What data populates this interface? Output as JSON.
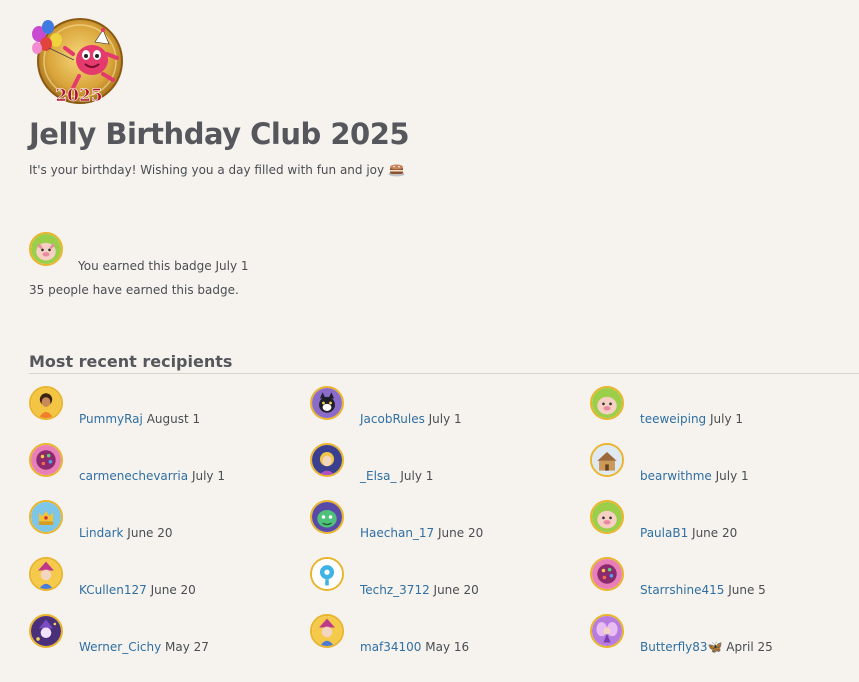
{
  "badge": {
    "year_label": "2025",
    "title": "Jelly Birthday Club 2025",
    "description": "It's your birthday! Wishing you a day filled with fun and joy",
    "description_icon": "cake-icon"
  },
  "earned": {
    "text": "You earned this badge July 1",
    "count_text": "35 people have earned this badge."
  },
  "recent": {
    "title": "Most recent recipients",
    "recipients": [
      {
        "name": "PummyRaj",
        "date": "August 1",
        "avatar": "girl-avatar"
      },
      {
        "name": "JacobRules",
        "date": "July 1",
        "avatar": "cat-avatar"
      },
      {
        "name": "teeweiping",
        "date": "July 1",
        "avatar": "pig-avatar"
      },
      {
        "name": "carmenechevarria",
        "date": "July 1",
        "avatar": "candy-ball-avatar"
      },
      {
        "name": "_Elsa_",
        "date": "July 1",
        "avatar": "princess-avatar"
      },
      {
        "name": "bearwithme",
        "date": "July 1",
        "avatar": "cookie-house-avatar"
      },
      {
        "name": "Lindark",
        "date": "June 20",
        "avatar": "crown-avatar"
      },
      {
        "name": "Haechan_17",
        "date": "June 20",
        "avatar": "green-creature-avatar"
      },
      {
        "name": "PaulaB1",
        "date": "June 20",
        "avatar": "pig-avatar"
      },
      {
        "name": "KCullen127",
        "date": "June 20",
        "avatar": "witch-girl-avatar"
      },
      {
        "name": "Techz_3712",
        "date": "June 20",
        "avatar": "blue-lamp-avatar"
      },
      {
        "name": "Starrshine415",
        "date": "June 5",
        "avatar": "candy-ball-avatar"
      },
      {
        "name": "Werner_Cichy",
        "date": "May 27",
        "avatar": "purple-wizard-avatar"
      },
      {
        "name": "maf34100",
        "date": "May 16",
        "avatar": "witch-girl-avatar"
      },
      {
        "name": "Butterfly83",
        "name_suffix": "🦋",
        "date": "April 25",
        "avatar": "purple-fairy-avatar"
      }
    ]
  }
}
